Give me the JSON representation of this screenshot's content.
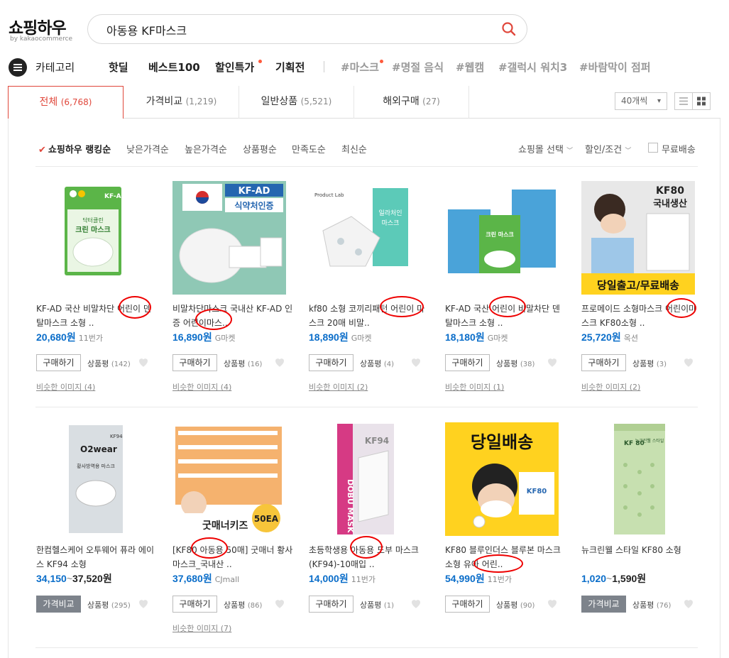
{
  "header": {
    "logo": "쇼핑하우",
    "logo_sub": "by kakaocommerce",
    "search_value": "아동용 KF마스크"
  },
  "nav": {
    "category": "카테고리",
    "items": [
      "핫딜",
      "베스트100",
      "할인특가",
      "기획전"
    ],
    "hashtags": [
      "#마스크",
      "#명절 음식",
      "#웹캠",
      "#갤럭시 워치3",
      "#바람막이 점퍼"
    ]
  },
  "tabs": [
    {
      "label": "전체",
      "count": "(6,768)"
    },
    {
      "label": "가격비교",
      "count": "(1,219)"
    },
    {
      "label": "일반상품",
      "count": "(5,521)"
    },
    {
      "label": "해외구매",
      "count": "(27)"
    }
  ],
  "per_page": "40개씩",
  "sort": {
    "options": [
      "쇼핑하우 랭킹순",
      "낮은가격순",
      "높은가격순",
      "상품평순",
      "만족도순",
      "최신순"
    ],
    "mall_select": "쇼핑몰 선택",
    "discount": "할인/조건",
    "free_ship": "무료배송"
  },
  "products": [
    {
      "title": "KF-AD 국산 비말차단 어린이 덴탈마스크 소형 ..",
      "price": "20,680원",
      "mall": "11번가",
      "btn": "구매하기",
      "review_label": "상품평",
      "review_count": "(142)",
      "similar": "비슷한 이미지 (4)"
    },
    {
      "title": "비말차단마스크 국내산 KF-AD 인증 어린이마스..",
      "price": "16,890원",
      "mall": "G마켓",
      "btn": "구매하기",
      "review_label": "상품평",
      "review_count": "(16)",
      "similar": "비슷한 이미지 (4)"
    },
    {
      "title": "kf80 소형 코끼리패턴 어린이 마스크 20매 비말..",
      "price": "18,890원",
      "mall": "G마켓",
      "btn": "구매하기",
      "review_label": "상품평",
      "review_count": "(4)",
      "similar": "비슷한 이미지 (2)"
    },
    {
      "title": "KF-AD 국산 어린이 비말차단 덴탈마스크 소형 ..",
      "price": "18,180원",
      "mall": "G마켓",
      "btn": "구매하기",
      "review_label": "상품평",
      "review_count": "(38)",
      "similar": "비슷한 이미지 (1)"
    },
    {
      "title": "프로메이드 소형마스크 어린이마스크 KF80소형 ..",
      "price": "25,720원",
      "mall": "옥션",
      "btn": "구매하기",
      "review_label": "상품평",
      "review_count": "(3)",
      "similar": "비슷한 이미지 (2)"
    },
    {
      "title": "한컴헬스케어 오투웨어 퓨라 에이스 KF94 소형",
      "price_from": "34,150",
      "price_tilde": "~",
      "price": "37,520원",
      "mall": "",
      "btn": "가격비교",
      "review_label": "상품평",
      "review_count": "(295)",
      "similar": ""
    },
    {
      "title": "[KF80 아동용 50매] 굿매너 황사마스크_국내산 ..",
      "price": "37,680원",
      "mall": "CJmall",
      "btn": "구매하기",
      "review_label": "상품평",
      "review_count": "(86)",
      "similar": "비슷한 이미지 (7)"
    },
    {
      "title": "초등학생용 아동용 도부 마스크(KF94)-10매입 ..",
      "price": "14,000원",
      "mall": "11번가",
      "btn": "구매하기",
      "review_label": "상품평",
      "review_count": "(1)",
      "similar": ""
    },
    {
      "title": "KF80 블루인더스 블루본 마스크 소형 유아 어린..",
      "price": "54,990원",
      "mall": "11번가",
      "btn": "구매하기",
      "review_label": "상품평",
      "review_count": "(90)",
      "similar": ""
    },
    {
      "title": "뉴크린웰 스타일 KF80 소형",
      "price_from": "1,020",
      "price_tilde": "~",
      "price": "1,590원",
      "mall": "",
      "btn": "가격비교",
      "review_label": "상품평",
      "review_count": "(76)",
      "similar": ""
    }
  ],
  "thumb_text": {
    "p1_badge": "KF-AD",
    "p1_brand": "닥터클린",
    "p1_name": "크린 마스크",
    "p2_top": "KF-AD",
    "p2_sub": "식약처인증",
    "p3_brand": "Product Lab",
    "p3_box": "일라처인 마스크",
    "p4_name": "크린 마스크",
    "p5_top": "KF80",
    "p5_sub": "국내생산",
    "p5_bottom": "당일출고/무료배송",
    "p6_brand": "O2wear",
    "p6_name": "황사방역용 마스크",
    "p6_kf": "KF94",
    "p7_name": "굿매너키즈",
    "p7_ea": "50EA",
    "p8_brand": "DOBU MASK",
    "p8_kf": "KF94",
    "p9_top": "당일배송",
    "p9_kf": "KF80",
    "p10_kf": "KF 80",
    "p10_name": "뉴크린웰 스타일"
  },
  "colors": {
    "accent": "#e0473b",
    "price": "#0a6dc9",
    "annotation": "#e00000"
  }
}
